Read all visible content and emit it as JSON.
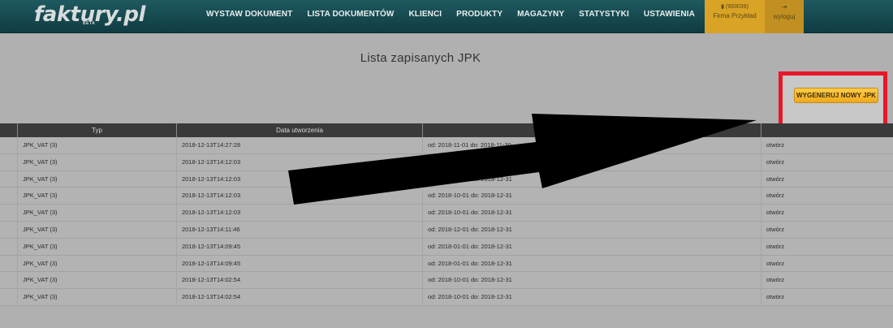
{
  "header": {
    "logo": "faktury.pl",
    "logo_badge": "BETA",
    "nav": [
      "WYSTAW DOKUMENT",
      "LISTA DOKUMENTÓW",
      "KLIENCI",
      "PRODUKTY",
      "MAGAZYNY",
      "STATYSTYKI",
      "USTAWIENIA"
    ],
    "company_id": "(993039)",
    "company_name": "Firma Przykład",
    "logout": "wyloguj",
    "colors": {
      "bar": "#0f3c42",
      "company": "#d9a326",
      "logout": "#c29022"
    }
  },
  "main": {
    "title": "Lista zapisanych JPK",
    "generate_button": "WYGENERUJ NOWY JPK",
    "highlight_color": "#e8172a"
  },
  "table": {
    "headers": [
      "",
      "Typ",
      "Data utworzenia",
      "",
      ""
    ],
    "rows": [
      {
        "type": "JPK_VAT (3)",
        "created": "2018-12-13T14:27:28",
        "period": "od: 2018-11-01 do: 2018-11-30",
        "action": "otwórz"
      },
      {
        "type": "JPK_VAT (3)",
        "created": "2018-12-13T14:12:03",
        "period": "od: 2018-10-01 do: 2018-12-31",
        "action": "otwórz"
      },
      {
        "type": "JPK_VAT (3)",
        "created": "2018-12-13T14:12:03",
        "period": "od: 2018-10-01 do: 2018-12-31",
        "action": "otwórz"
      },
      {
        "type": "JPK_VAT (3)",
        "created": "2018-12-13T14:12:03",
        "period": "od: 2018-10-01 do: 2018-12-31",
        "action": "otwórz"
      },
      {
        "type": "JPK_VAT (3)",
        "created": "2018-12-13T14:12:03",
        "period": "od: 2018-10-01 do: 2018-12-31",
        "action": "otwórz"
      },
      {
        "type": "JPK_VAT (3)",
        "created": "2018-12-13T14:11:46",
        "period": "od: 2018-12-01 do: 2018-12-31",
        "action": "otwórz"
      },
      {
        "type": "JPK_VAT (3)",
        "created": "2018-12-13T14:09:45",
        "period": "od: 2018-01-01 do: 2018-12-31",
        "action": "otwórz"
      },
      {
        "type": "JPK_VAT (3)",
        "created": "2018-12-13T14:09:45",
        "period": "od: 2018-01-01 do: 2018-12-31",
        "action": "otwórz"
      },
      {
        "type": "JPK_VAT (3)",
        "created": "2018-12-13T14:02:54",
        "period": "od: 2018-10-01 do: 2018-12-31",
        "action": "otwórz"
      },
      {
        "type": "JPK_VAT (3)",
        "created": "2018-12-13T14:02:54",
        "period": "od: 2018-10-01 do: 2018-12-31",
        "action": "otwórz"
      }
    ]
  },
  "annotation": {
    "arrow_icon": "arrow-pointer-icon",
    "arrow_color": "#000000"
  }
}
